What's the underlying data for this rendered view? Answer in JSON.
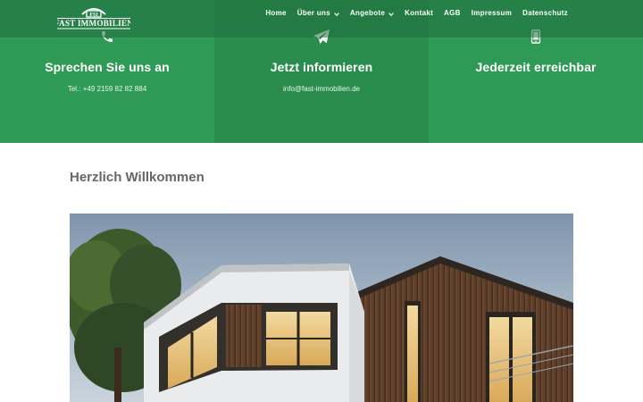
{
  "header": {
    "logo_text": "FAST IMMOBILIEN",
    "logo_monogram": "FSI",
    "nav": [
      {
        "label": "Home",
        "has_dropdown": false
      },
      {
        "label": "Über uns",
        "has_dropdown": true
      },
      {
        "label": "Angebote",
        "has_dropdown": true
      },
      {
        "label": "Kontakt",
        "has_dropdown": false
      },
      {
        "label": "AGB",
        "has_dropdown": false
      },
      {
        "label": "Impressum",
        "has_dropdown": false
      },
      {
        "label": "Datenschutz",
        "has_dropdown": false
      }
    ]
  },
  "contact": [
    {
      "icon": "phone-icon",
      "title": "Sprechen Sie uns an",
      "text": "Tel.: +49 2159 82 82 884"
    },
    {
      "icon": "paper-plane-icon",
      "title": "Jetzt informieren",
      "text": "info@fast-immobilien.de"
    },
    {
      "icon": "mobile-icon",
      "title": "Jederzeit erreichbar",
      "text": ""
    }
  ],
  "main": {
    "welcome_title": "Herzlich Willkommen"
  },
  "colors": {
    "green": "#2f9a55",
    "green_dark": "#2a8d4d",
    "heading_gray": "#666666"
  }
}
